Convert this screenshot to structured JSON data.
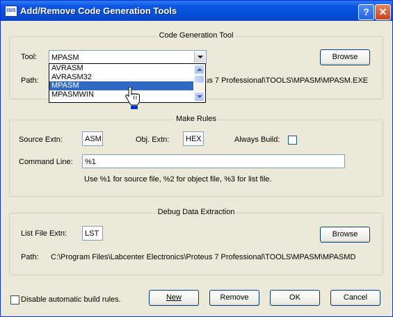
{
  "window": {
    "title": "Add/Remove Code Generation Tools",
    "icon_text": "ISIS",
    "help_glyph": "?",
    "close_glyph": "✕"
  },
  "code_gen": {
    "legend": "Code Generation Tool",
    "tool_label": "Tool:",
    "tool_value": "MPASM",
    "browse_label": "Browse",
    "path_label": "Path:",
    "path_value": "C:\\Program Files\\Labcenter Electronics\\Proteus 7 Professional\\TOOLS\\MPASM\\MPASM.EXE",
    "dropdown_options": [
      "AVRASM",
      "AVRASM32",
      "MPASM",
      "MPASMWIN"
    ],
    "selected_option": "MPASM"
  },
  "make_rules": {
    "legend": "Make Rules",
    "source_label": "Source Extn:",
    "source_value": "ASM",
    "obj_label": "Obj. Extn:",
    "obj_value": "HEX",
    "always_build_label": "Always Build:",
    "always_build_checked": false,
    "command_label": "Command Line:",
    "command_value": "%1",
    "hint": "Use %1 for source file, %2 for object file, %3 for list file."
  },
  "debug": {
    "legend": "Debug Data Extraction",
    "list_label": "List File Extn:",
    "list_value": "LST",
    "browse_label": "Browse",
    "path_label": "Path:",
    "path_value": "C:\\Program Files\\Labcenter Electronics\\Proteus 7 Professional\\TOOLS\\MPASM\\MPASMDDX.EXE"
  },
  "footer": {
    "disable_label": "Disable automatic build rules.",
    "disable_checked": false,
    "new_label": "New",
    "remove_label": "Remove",
    "ok_label": "OK",
    "cancel_label": "Cancel"
  },
  "colors": {
    "title_bar": "#0a54e3",
    "selection": "#316ac5",
    "dialog_bg": "#ece9d8"
  }
}
